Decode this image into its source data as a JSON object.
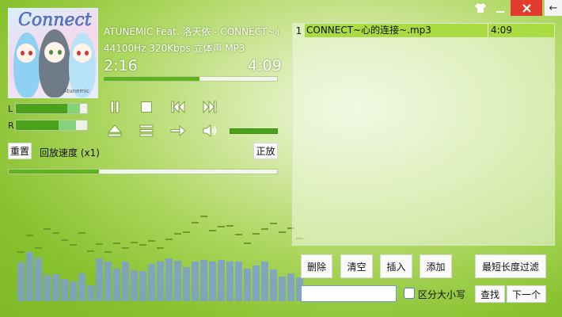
{
  "window": {
    "skin_icon": "tshirt-icon",
    "minimize_icon": "minimize-icon",
    "close_label": "×",
    "back_label": "←"
  },
  "album_art": {
    "title_text": "Connect",
    "caption_text": "Atunemic"
  },
  "track": {
    "title": "ATUNEMIC Feat. 洛天依 - CONNECT~心的",
    "format": "44100Hz 320Kbps 立体声 MP3",
    "elapsed": "2:16",
    "total": "4:09",
    "progress": 0.553
  },
  "vu": {
    "left_label": "L",
    "right_label": "R",
    "left_level": 0.72,
    "left_peak": 0.9,
    "right_level": 0.6,
    "right_peak": 0.84
  },
  "controls": {
    "pause": "pause-icon",
    "stop": "stop-icon",
    "previous": "previous-track-icon",
    "next": "next-track-icon",
    "eject": "eject-icon",
    "playlist": "list-icon",
    "order": "arrow-right-icon",
    "volume": "speaker-icon",
    "volume_level": 1.0
  },
  "speed": {
    "reset_label": "重置",
    "speed_label": "回放速度 (x1)",
    "direction_label": "正放",
    "speed_position": 0.335
  },
  "spectrum": {
    "bars": [
      0.54,
      0.69,
      0.61,
      0.37,
      0.38,
      0.31,
      0.28,
      0.39,
      0.22,
      0.6,
      0.56,
      0.46,
      0.55,
      0.43,
      0.42,
      0.52,
      0.55,
      0.6,
      0.57,
      0.48,
      0.55,
      0.58,
      0.56,
      0.58,
      0.56,
      0.55,
      0.46,
      0.5,
      0.55,
      0.44,
      0.34,
      0.39,
      0.33
    ],
    "peaks": [
      0.7,
      0.93,
      0.76,
      1.02,
      0.97,
      0.87,
      0.8,
      0.97,
      0.71,
      0.81,
      0.7,
      0.82,
      0.76,
      0.83,
      0.8,
      0.86,
      0.76,
      0.88,
      0.96,
      0.98,
      1.11,
      1.2,
      1.0,
      1.06,
      1.07,
      0.94,
      0.82,
      0.96,
      1.02,
      1.1,
      0.98,
      1.03,
      0.89
    ]
  },
  "playlist": {
    "items": [
      {
        "number": "1",
        "name": "CONNECT~心的连接~.mp3",
        "duration": "4:09"
      }
    ]
  },
  "playlist_buttons": {
    "delete": "删除",
    "clear": "清空",
    "insert": "插入",
    "add": "添加",
    "min_length_filter": "最短长度过滤"
  },
  "search": {
    "value": "",
    "placeholder": "",
    "case_label": "区分大小写",
    "find": "查找",
    "next": "下一个"
  }
}
